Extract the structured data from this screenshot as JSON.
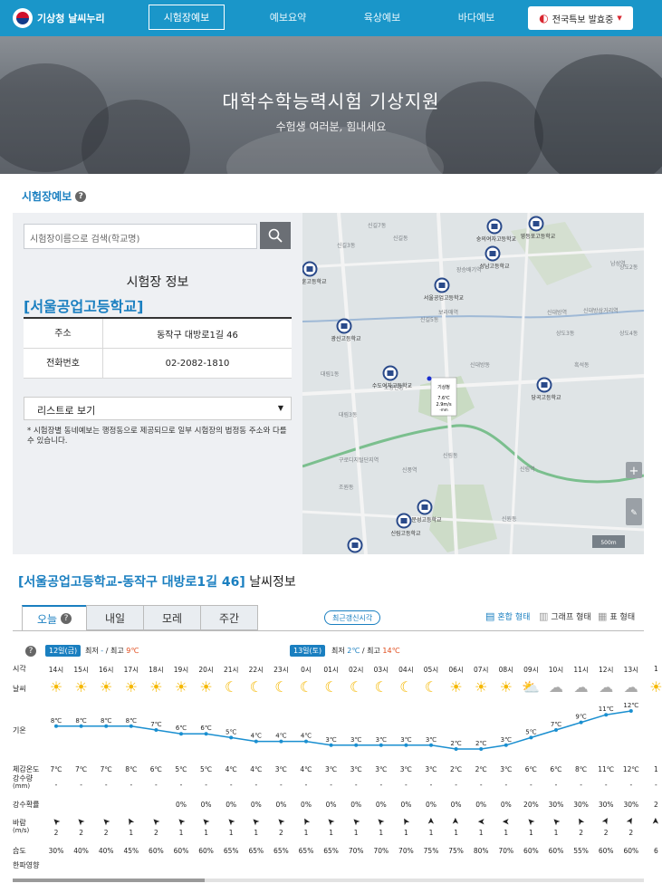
{
  "header": {
    "logo_text": "기상청 날씨누리",
    "nav": [
      {
        "label": "시험장예보",
        "active": true
      },
      {
        "label": "예보요약",
        "active": false
      },
      {
        "label": "육상예보",
        "active": false
      },
      {
        "label": "바다예보",
        "active": false
      }
    ],
    "alert_label": "전국특보 발효중",
    "alert_icon": "siren-icon"
  },
  "hero": {
    "title": "대학수학능력시험 기상지원",
    "subtitle": "수험생 여러분, 힘내세요"
  },
  "section_title": "시험장예보",
  "panel": {
    "search_placeholder": "시험장이름으로 검색(학교명)",
    "info_title": "시험장 정보",
    "school_name": "[서울공업고등학교]",
    "rows": [
      {
        "key": "주소",
        "value": "동작구 대방로1길 46"
      },
      {
        "key": "전화번호",
        "value": "02-2082-1810"
      }
    ],
    "select_value": "리스트로 보기",
    "note": "* 시험장별 동네예보는 행정동으로 제공되므로 일부 시험장의 법정동 주소와 다를 수 있습니다."
  },
  "map": {
    "labels": [
      "신길7동",
      "신길3동",
      "신길동",
      "신길5동",
      "대림1동",
      "대림3동",
      "상도3동",
      "상도4동",
      "상도2동",
      "신대방동",
      "흑석동",
      "신림동",
      "조원동",
      "신원동",
      "노량진동",
      "신풍역",
      "보라매역",
      "신대방역",
      "신림역",
      "구로디지털단지역",
      "장승배기역",
      "신대방삼거리역",
      "남성역"
    ],
    "pins": [
      "영등포고등학교",
      "숭의여자고등학교",
      "성남고등학교",
      "서울공업고등학교",
      "장훈고등학교",
      "광신고등학교",
      "수도여자고등학교",
      "당곡고등학교",
      "문성고등학교",
      "신림고등학교",
      "대영고등학교"
    ],
    "popup": {
      "title": "기상청",
      "line1": "7.6℃",
      "line2": "2.9m/s",
      "line3": "-mm"
    },
    "scale": "500m"
  },
  "weather": {
    "title_bold": "[서울공업고등학교-동작구 대방로1길 46]",
    "title_rest": " 날씨정보",
    "tabs": [
      "오늘",
      "내일",
      "모레",
      "주간"
    ],
    "recent_label": "최근갱신시각",
    "view_modes": [
      {
        "label": "혼합 형태",
        "active": true
      },
      {
        "label": "그래프 형태",
        "active": false
      },
      {
        "label": "표 형태",
        "active": false
      }
    ],
    "day1": {
      "date": "12일(금)",
      "min_label": "최저",
      "min": "-",
      "max_label": "최고",
      "max": "9℃"
    },
    "day2": {
      "date": "13일(토)",
      "min_label": "최저",
      "min": "2℃",
      "max_label": "최고",
      "max": "14℃"
    },
    "row_labels": {
      "time": "시각",
      "weather": "날씨",
      "temp": "기온",
      "feel": "체감온도",
      "rain": "강수량",
      "rain_unit": "(mm)",
      "prob": "강수확률",
      "wind": "바람",
      "wind_unit": "(m/s)",
      "humid": "습도",
      "cold": "한파영향"
    },
    "hours": [
      "14시",
      "15시",
      "16시",
      "17시",
      "18시",
      "19시",
      "20시",
      "21시",
      "22시",
      "23시",
      "0시",
      "01시",
      "02시",
      "03시",
      "04시",
      "05시",
      "06시",
      "07시",
      "08시",
      "09시",
      "10시",
      "11시",
      "12시",
      "13시",
      "1"
    ],
    "icons": [
      "sun",
      "sun",
      "sun",
      "sun",
      "sun",
      "sun",
      "sun",
      "moon",
      "moon",
      "moon",
      "moon",
      "moon",
      "moon",
      "moon",
      "moon",
      "moon",
      "sun",
      "sun",
      "sun",
      "partly-cloudy",
      "cloudy",
      "cloudy",
      "cloudy",
      "cloudy",
      "sun"
    ],
    "temps": [
      8,
      8,
      8,
      8,
      7,
      6,
      6,
      5,
      4,
      4,
      4,
      3,
      3,
      3,
      3,
      3,
      2,
      2,
      3,
      5,
      7,
      9,
      11,
      12,
      1
    ],
    "temp_labels": [
      "8℃",
      "8℃",
      "8℃",
      "8℃",
      "7℃",
      "6℃",
      "6℃",
      "5℃",
      "4℃",
      "4℃",
      "4℃",
      "3℃",
      "3℃",
      "3℃",
      "3℃",
      "3℃",
      "2℃",
      "2℃",
      "3℃",
      "5℃",
      "7℃",
      "9℃",
      "11℃",
      "12℃",
      "1"
    ],
    "feel": [
      "7℃",
      "7℃",
      "7℃",
      "8℃",
      "6℃",
      "5℃",
      "5℃",
      "4℃",
      "4℃",
      "3℃",
      "4℃",
      "3℃",
      "3℃",
      "3℃",
      "3℃",
      "3℃",
      "2℃",
      "2℃",
      "3℃",
      "6℃",
      "6℃",
      "8℃",
      "11℃",
      "12℃",
      "1"
    ],
    "rain": [
      "-",
      "-",
      "-",
      "-",
      "-",
      "-",
      "-",
      "-",
      "-",
      "-",
      "-",
      "-",
      "-",
      "-",
      "-",
      "-",
      "-",
      "-",
      "-",
      "-",
      "-",
      "-",
      "-",
      "-",
      "-"
    ],
    "prob": [
      "",
      "",
      "",
      "",
      "",
      "0%",
      "0%",
      "0%",
      "0%",
      "0%",
      "0%",
      "0%",
      "0%",
      "0%",
      "0%",
      "0%",
      "0%",
      "0%",
      "0%",
      "20%",
      "30%",
      "30%",
      "30%",
      "30%",
      "2"
    ],
    "wind_dirs": [
      315,
      315,
      315,
      330,
      315,
      315,
      315,
      315,
      315,
      315,
      330,
      315,
      315,
      315,
      330,
      0,
      0,
      270,
      270,
      315,
      315,
      330,
      30,
      30,
      0
    ],
    "wind_speeds": [
      "2",
      "2",
      "2",
      "1",
      "2",
      "1",
      "1",
      "1",
      "1",
      "2",
      "1",
      "1",
      "1",
      "1",
      "1",
      "1",
      "1",
      "1",
      "1",
      "1",
      "1",
      "2",
      "2",
      "2",
      ""
    ],
    "humid": [
      "30%",
      "40%",
      "40%",
      "45%",
      "60%",
      "60%",
      "60%",
      "65%",
      "65%",
      "65%",
      "65%",
      "65%",
      "70%",
      "70%",
      "70%",
      "75%",
      "75%",
      "80%",
      "70%",
      "60%",
      "60%",
      "55%",
      "60%",
      "60%",
      "6"
    ]
  }
}
